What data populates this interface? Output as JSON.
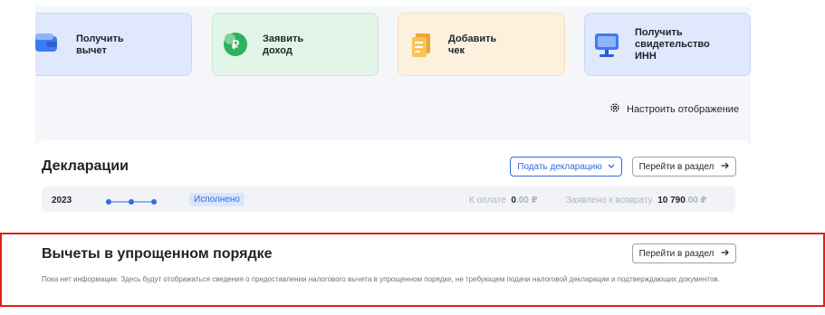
{
  "colors": {
    "accent": "#2f6ce5",
    "highlight_frame": "#e0211c",
    "tile_blue": "#dfe8fd",
    "tile_green": "#e3f4e8",
    "tile_orange": "#fdf1de"
  },
  "tiles": [
    {
      "label": "Получить\nвычет",
      "icon": "wallet-icon"
    },
    {
      "label": "Заявить\nдоход",
      "icon": "ruble-leaf-icon"
    },
    {
      "label": "Добавить\nчек",
      "icon": "receipt-icon"
    },
    {
      "label": "Получить\nсвидетельство\nИНН",
      "icon": "monitor-icon"
    }
  ],
  "settings": {
    "label": "Настроить отображение",
    "icon": "gear-icon"
  },
  "declarations": {
    "title": "Декларации",
    "submit_button": "Подать декларацию",
    "goto_button": "Перейти в раздел",
    "row": {
      "year": "2023",
      "status": "Исполнено",
      "pay_label": "К оплате",
      "pay_int": "0",
      "pay_frac": ".00 ₽",
      "refund_label": "Заявлено к возврату",
      "refund_int": "10 790",
      "refund_frac": ".00 ₽"
    }
  },
  "simplified": {
    "title": "Вычеты в упрощенном порядке",
    "goto_button": "Перейти в раздел",
    "text": "Пока нет информации. Здесь будут отображаться сведения о предоставлении налогового вычета в упрощенном порядке, не требующем подачи налоговой декларации и подтверждающих документов."
  }
}
